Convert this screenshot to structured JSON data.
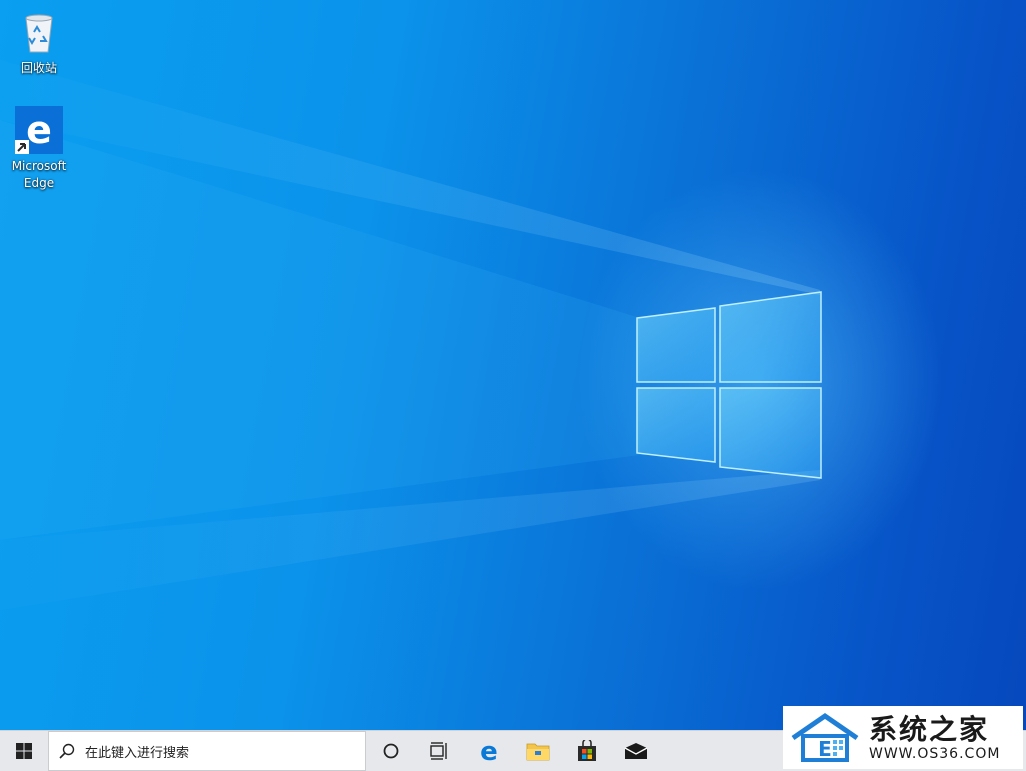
{
  "desktop": {
    "icons": [
      {
        "label": "回收站",
        "icon": "recycle-bin-icon"
      },
      {
        "label": "Microsoft Edge",
        "icon": "edge-icon"
      }
    ]
  },
  "taskbar": {
    "start_icon": "windows-start-icon",
    "search_placeholder": "在此键入进行搜索",
    "pinned": [
      {
        "name": "cortana",
        "icon": "cortana-icon"
      },
      {
        "name": "task-view",
        "icon": "task-view-icon"
      },
      {
        "name": "edge",
        "icon": "edge-icon"
      },
      {
        "name": "file-explorer",
        "icon": "folder-icon"
      },
      {
        "name": "store",
        "icon": "store-icon"
      },
      {
        "name": "mail",
        "icon": "mail-icon"
      }
    ]
  },
  "watermark": {
    "title": "系统之家",
    "url": "WWW.OS36.COM"
  },
  "colors": {
    "desktop_light": "#0a9ff0",
    "desktop_dark": "#0648bd",
    "taskbar": "#e6e8ec",
    "accent": "#0078d7"
  }
}
